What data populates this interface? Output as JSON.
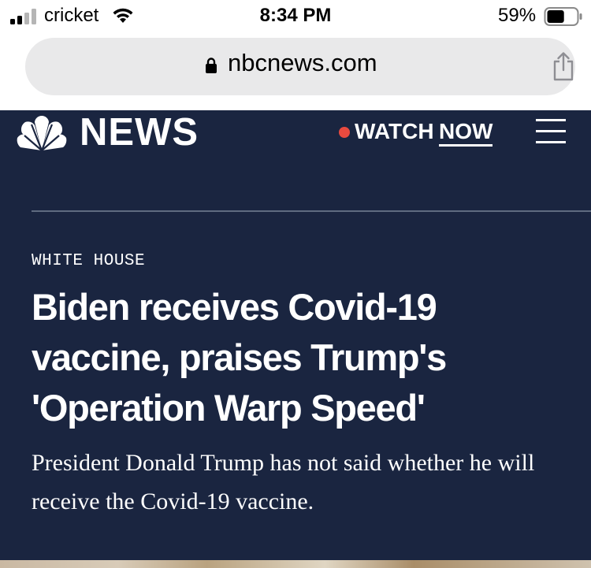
{
  "status_bar": {
    "carrier": "cricket",
    "time": "8:34 PM",
    "battery_percent": "59%",
    "battery_level": 0.59
  },
  "browser": {
    "url": "nbcnews.com"
  },
  "header": {
    "logo_text": "NEWS",
    "watch_label": "WATCH",
    "now_label": "NOW",
    "live_dot_color": "#e84a3f"
  },
  "article": {
    "section": "WHITE HOUSE",
    "headline": "Biden receives Covid-19 vaccine, praises Trump's 'Operation Warp Speed'",
    "dek": "President Donald Trump has not said whether he will receive the Covid-19 vaccine."
  },
  "colors": {
    "site_background": "#1a2540",
    "url_bar_background": "#e9e9ea"
  }
}
